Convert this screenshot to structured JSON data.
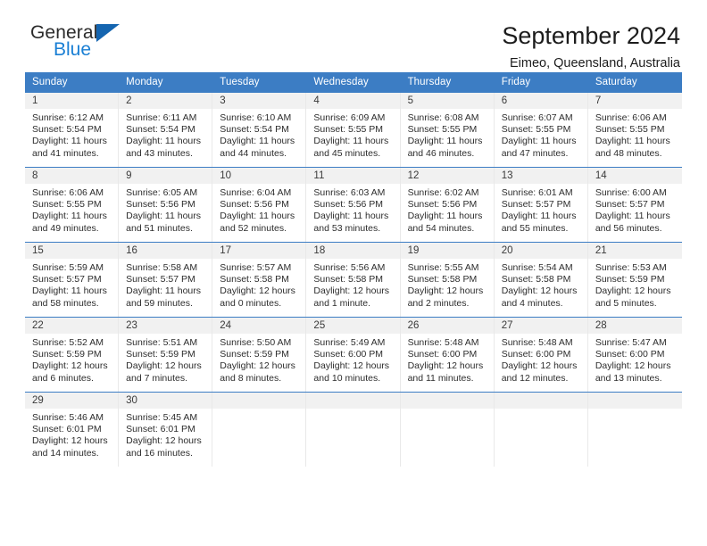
{
  "brand": {
    "name_top": "General",
    "name_bottom": "Blue",
    "triangle_color": "#1565b0",
    "blue_text_color": "#1a7fd4"
  },
  "header": {
    "title": "September 2024",
    "subtitle": "Eimeo, Queensland, Australia"
  },
  "theme": {
    "header_row_bg": "#3c7dc4",
    "day_number_bg": "#f1f1f1",
    "cell_bg": "#ffffff",
    "grid_line": "#e9e9e9"
  },
  "weekdays": [
    "Sunday",
    "Monday",
    "Tuesday",
    "Wednesday",
    "Thursday",
    "Friday",
    "Saturday"
  ],
  "weeks": [
    [
      {
        "day": "1",
        "sunrise": "Sunrise: 6:12 AM",
        "sunset": "Sunset: 5:54 PM",
        "daylight1": "Daylight: 11 hours",
        "daylight2": "and 41 minutes."
      },
      {
        "day": "2",
        "sunrise": "Sunrise: 6:11 AM",
        "sunset": "Sunset: 5:54 PM",
        "daylight1": "Daylight: 11 hours",
        "daylight2": "and 43 minutes."
      },
      {
        "day": "3",
        "sunrise": "Sunrise: 6:10 AM",
        "sunset": "Sunset: 5:54 PM",
        "daylight1": "Daylight: 11 hours",
        "daylight2": "and 44 minutes."
      },
      {
        "day": "4",
        "sunrise": "Sunrise: 6:09 AM",
        "sunset": "Sunset: 5:55 PM",
        "daylight1": "Daylight: 11 hours",
        "daylight2": "and 45 minutes."
      },
      {
        "day": "5",
        "sunrise": "Sunrise: 6:08 AM",
        "sunset": "Sunset: 5:55 PM",
        "daylight1": "Daylight: 11 hours",
        "daylight2": "and 46 minutes."
      },
      {
        "day": "6",
        "sunrise": "Sunrise: 6:07 AM",
        "sunset": "Sunset: 5:55 PM",
        "daylight1": "Daylight: 11 hours",
        "daylight2": "and 47 minutes."
      },
      {
        "day": "7",
        "sunrise": "Sunrise: 6:06 AM",
        "sunset": "Sunset: 5:55 PM",
        "daylight1": "Daylight: 11 hours",
        "daylight2": "and 48 minutes."
      }
    ],
    [
      {
        "day": "8",
        "sunrise": "Sunrise: 6:06 AM",
        "sunset": "Sunset: 5:55 PM",
        "daylight1": "Daylight: 11 hours",
        "daylight2": "and 49 minutes."
      },
      {
        "day": "9",
        "sunrise": "Sunrise: 6:05 AM",
        "sunset": "Sunset: 5:56 PM",
        "daylight1": "Daylight: 11 hours",
        "daylight2": "and 51 minutes."
      },
      {
        "day": "10",
        "sunrise": "Sunrise: 6:04 AM",
        "sunset": "Sunset: 5:56 PM",
        "daylight1": "Daylight: 11 hours",
        "daylight2": "and 52 minutes."
      },
      {
        "day": "11",
        "sunrise": "Sunrise: 6:03 AM",
        "sunset": "Sunset: 5:56 PM",
        "daylight1": "Daylight: 11 hours",
        "daylight2": "and 53 minutes."
      },
      {
        "day": "12",
        "sunrise": "Sunrise: 6:02 AM",
        "sunset": "Sunset: 5:56 PM",
        "daylight1": "Daylight: 11 hours",
        "daylight2": "and 54 minutes."
      },
      {
        "day": "13",
        "sunrise": "Sunrise: 6:01 AM",
        "sunset": "Sunset: 5:57 PM",
        "daylight1": "Daylight: 11 hours",
        "daylight2": "and 55 minutes."
      },
      {
        "day": "14",
        "sunrise": "Sunrise: 6:00 AM",
        "sunset": "Sunset: 5:57 PM",
        "daylight1": "Daylight: 11 hours",
        "daylight2": "and 56 minutes."
      }
    ],
    [
      {
        "day": "15",
        "sunrise": "Sunrise: 5:59 AM",
        "sunset": "Sunset: 5:57 PM",
        "daylight1": "Daylight: 11 hours",
        "daylight2": "and 58 minutes."
      },
      {
        "day": "16",
        "sunrise": "Sunrise: 5:58 AM",
        "sunset": "Sunset: 5:57 PM",
        "daylight1": "Daylight: 11 hours",
        "daylight2": "and 59 minutes."
      },
      {
        "day": "17",
        "sunrise": "Sunrise: 5:57 AM",
        "sunset": "Sunset: 5:58 PM",
        "daylight1": "Daylight: 12 hours",
        "daylight2": "and 0 minutes."
      },
      {
        "day": "18",
        "sunrise": "Sunrise: 5:56 AM",
        "sunset": "Sunset: 5:58 PM",
        "daylight1": "Daylight: 12 hours",
        "daylight2": "and 1 minute."
      },
      {
        "day": "19",
        "sunrise": "Sunrise: 5:55 AM",
        "sunset": "Sunset: 5:58 PM",
        "daylight1": "Daylight: 12 hours",
        "daylight2": "and 2 minutes."
      },
      {
        "day": "20",
        "sunrise": "Sunrise: 5:54 AM",
        "sunset": "Sunset: 5:58 PM",
        "daylight1": "Daylight: 12 hours",
        "daylight2": "and 4 minutes."
      },
      {
        "day": "21",
        "sunrise": "Sunrise: 5:53 AM",
        "sunset": "Sunset: 5:59 PM",
        "daylight1": "Daylight: 12 hours",
        "daylight2": "and 5 minutes."
      }
    ],
    [
      {
        "day": "22",
        "sunrise": "Sunrise: 5:52 AM",
        "sunset": "Sunset: 5:59 PM",
        "daylight1": "Daylight: 12 hours",
        "daylight2": "and 6 minutes."
      },
      {
        "day": "23",
        "sunrise": "Sunrise: 5:51 AM",
        "sunset": "Sunset: 5:59 PM",
        "daylight1": "Daylight: 12 hours",
        "daylight2": "and 7 minutes."
      },
      {
        "day": "24",
        "sunrise": "Sunrise: 5:50 AM",
        "sunset": "Sunset: 5:59 PM",
        "daylight1": "Daylight: 12 hours",
        "daylight2": "and 8 minutes."
      },
      {
        "day": "25",
        "sunrise": "Sunrise: 5:49 AM",
        "sunset": "Sunset: 6:00 PM",
        "daylight1": "Daylight: 12 hours",
        "daylight2": "and 10 minutes."
      },
      {
        "day": "26",
        "sunrise": "Sunrise: 5:48 AM",
        "sunset": "Sunset: 6:00 PM",
        "daylight1": "Daylight: 12 hours",
        "daylight2": "and 11 minutes."
      },
      {
        "day": "27",
        "sunrise": "Sunrise: 5:48 AM",
        "sunset": "Sunset: 6:00 PM",
        "daylight1": "Daylight: 12 hours",
        "daylight2": "and 12 minutes."
      },
      {
        "day": "28",
        "sunrise": "Sunrise: 5:47 AM",
        "sunset": "Sunset: 6:00 PM",
        "daylight1": "Daylight: 12 hours",
        "daylight2": "and 13 minutes."
      }
    ],
    [
      {
        "day": "29",
        "sunrise": "Sunrise: 5:46 AM",
        "sunset": "Sunset: 6:01 PM",
        "daylight1": "Daylight: 12 hours",
        "daylight2": "and 14 minutes."
      },
      {
        "day": "30",
        "sunrise": "Sunrise: 5:45 AM",
        "sunset": "Sunset: 6:01 PM",
        "daylight1": "Daylight: 12 hours",
        "daylight2": "and 16 minutes."
      },
      {
        "day": "",
        "sunrise": "",
        "sunset": "",
        "daylight1": "",
        "daylight2": ""
      },
      {
        "day": "",
        "sunrise": "",
        "sunset": "",
        "daylight1": "",
        "daylight2": ""
      },
      {
        "day": "",
        "sunrise": "",
        "sunset": "",
        "daylight1": "",
        "daylight2": ""
      },
      {
        "day": "",
        "sunrise": "",
        "sunset": "",
        "daylight1": "",
        "daylight2": ""
      },
      {
        "day": "",
        "sunrise": "",
        "sunset": "",
        "daylight1": "",
        "daylight2": ""
      }
    ]
  ]
}
